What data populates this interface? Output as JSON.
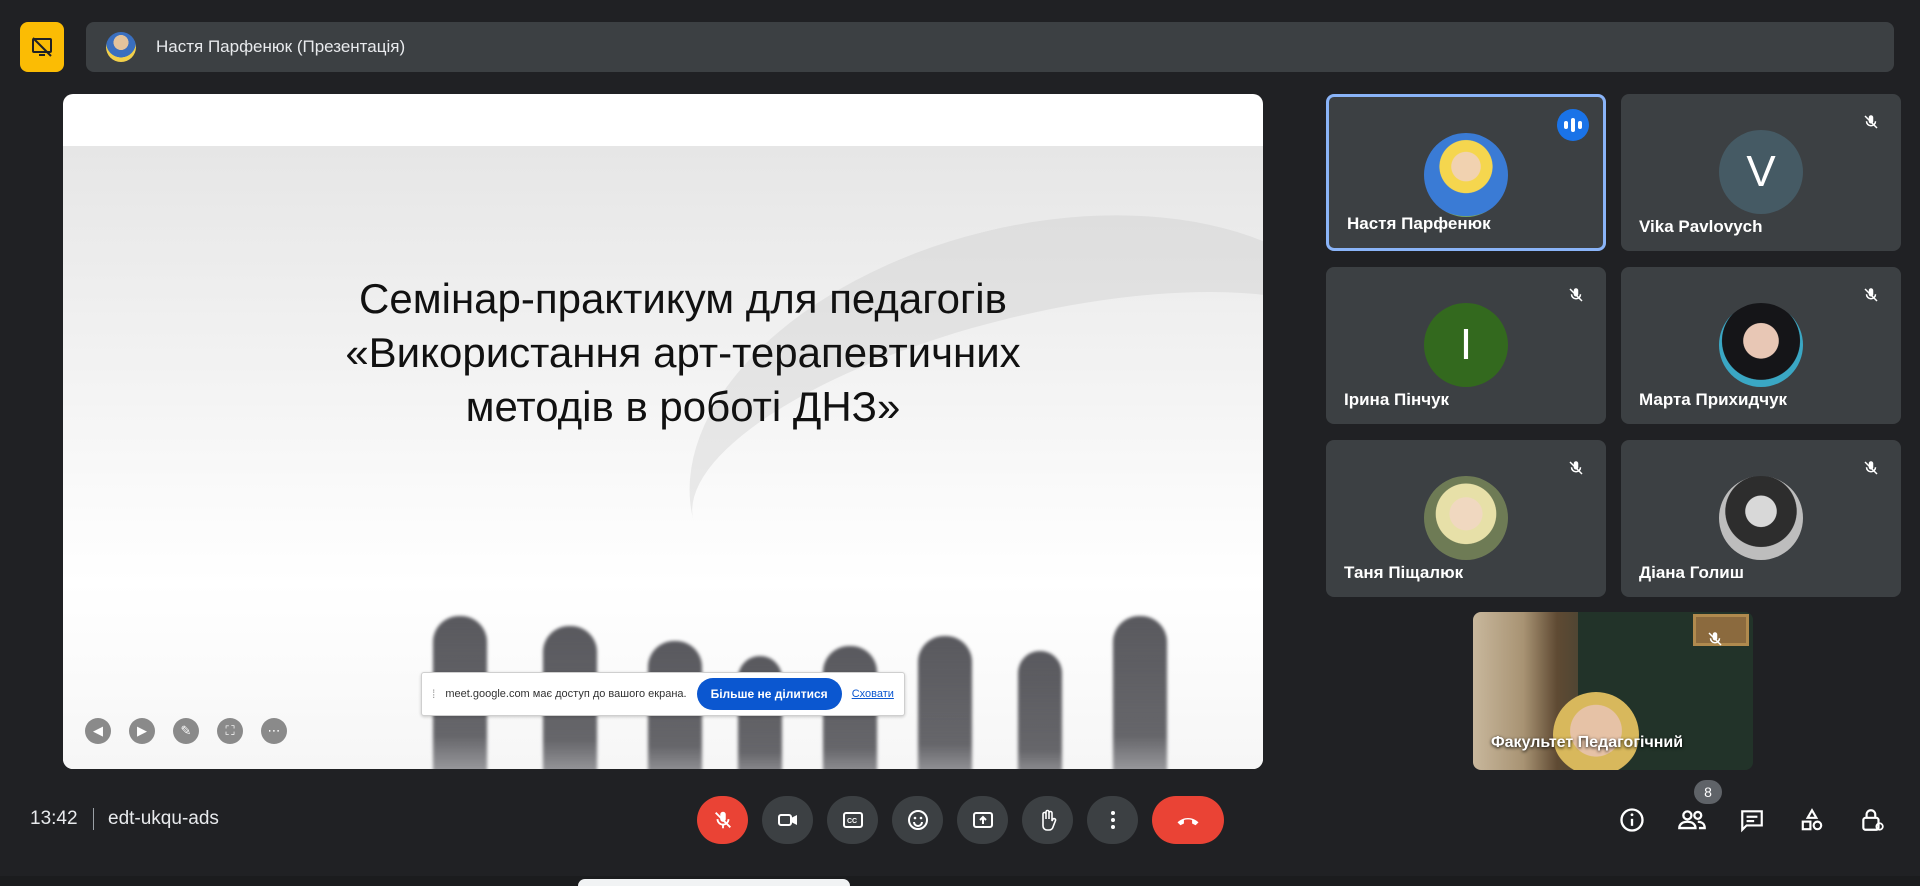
{
  "meeting": {
    "presenter_label": "Настя Парфенюк (Презентація)",
    "time": "13:42",
    "code": "edt-ukqu-ads",
    "participant_count": "8"
  },
  "slide": {
    "title_line1": "Семінар-практикум для педагогів",
    "title_line2": "«Використання    арт-терапевтичних",
    "title_line3": "методів в роботі   ДНЗ»"
  },
  "share_notice": {
    "message": "meet.google.com має доступ до вашого екрана.",
    "stop_label": "Більше не ділитися",
    "hide_label": "Сховати"
  },
  "participants": [
    {
      "name": "Настя Парфенюк",
      "initial": "",
      "color": "#c9a06a",
      "state": "speaking"
    },
    {
      "name": "Vika Pavlovych",
      "initial": "V",
      "color": "#455a64",
      "state": "muted"
    },
    {
      "name": "Ірина Пінчук",
      "initial": "I",
      "color": "#33691e",
      "state": "muted"
    },
    {
      "name": "Марта Прихидчук",
      "initial": "",
      "color": "#2b2b33",
      "state": "muted"
    },
    {
      "name": "Таня Піщалюк",
      "initial": "",
      "color": "#a8b4a0",
      "state": "muted"
    },
    {
      "name": "Діана Голиш",
      "initial": "",
      "color": "#8c8c8c",
      "state": "muted"
    }
  ],
  "self_view": {
    "name": "Факультет Педагогічний"
  },
  "icons": {
    "present": "presentation-off-icon",
    "mic": "mic-off-icon",
    "camera": "camera-icon",
    "captions": "captions-icon",
    "emoji": "emoji-icon",
    "share": "present-screen-icon",
    "hand": "raise-hand-icon",
    "more": "more-options-icon",
    "end": "end-call-icon",
    "info": "info-icon",
    "people": "people-icon",
    "chat": "chat-icon",
    "activities": "activities-icon",
    "host": "host-controls-icon"
  },
  "colors": {
    "accent": "#8ab4f8",
    "danger": "#ea4335",
    "present": "#fbbc04",
    "surface": "#3c4043"
  }
}
